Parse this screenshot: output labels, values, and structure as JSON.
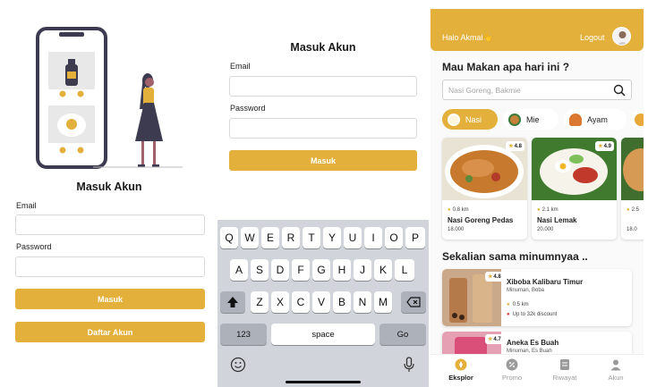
{
  "login1": {
    "title": "Masuk Akun",
    "email_label": "Email",
    "email_value": "",
    "password_label": "Password",
    "password_value": "",
    "login_button": "Masuk",
    "register_button": "Daftar Akun"
  },
  "login2": {
    "title": "Masuk Akun",
    "email_label": "Email",
    "email_value": "",
    "password_label": "Password",
    "password_value": "",
    "login_button": "Masuk"
  },
  "keyboard": {
    "row1": [
      "Q",
      "W",
      "E",
      "R",
      "T",
      "Y",
      "U",
      "I",
      "O",
      "P"
    ],
    "row2": [
      "A",
      "S",
      "D",
      "F",
      "G",
      "H",
      "J",
      "K",
      "L"
    ],
    "row3": [
      "Z",
      "X",
      "C",
      "V",
      "B",
      "N",
      "M"
    ],
    "numbers": "123",
    "space": "space",
    "go": "Go",
    "icons": [
      "shift-icon",
      "backspace-icon",
      "emoji-icon",
      "microphone-icon"
    ]
  },
  "home": {
    "greeting": "Halo Akmal👋",
    "logout": "Logout",
    "question": "Mau Makan apa hari ini ?",
    "search_placeholder": "Nasi Goreng, Bakmie",
    "categories": [
      {
        "label": "Nasi",
        "active": true
      },
      {
        "label": "Mie",
        "active": false
      },
      {
        "label": "Ayam",
        "active": false
      }
    ],
    "foods": [
      {
        "name": "Nasi Goreng Pedas",
        "distance": "0.8 km",
        "price": "18.000",
        "rating": "4.8"
      },
      {
        "name": "Nasi Lemak",
        "distance": "2.1 km",
        "price": "20.000",
        "rating": "4.9"
      },
      {
        "name": "",
        "distance": "2.5",
        "price": "18.0",
        "rating": ""
      }
    ],
    "drinks_title": "Sekalian sama minumnyaa ..",
    "drinks": [
      {
        "name": "Xiboba Kalibaru Timur",
        "subtitle": "Minuman, Boba",
        "distance": "0.5 km",
        "promo": "Up to 32k discount",
        "rating": "4.8"
      },
      {
        "name": "Aneka Es Buah",
        "subtitle": "Minuman, Es Buah",
        "distance": "",
        "promo": "",
        "rating": "4.7"
      }
    ],
    "nav": [
      {
        "label": "Eksplor",
        "active": true
      },
      {
        "label": "Promo",
        "active": false
      },
      {
        "label": "Riwayat",
        "active": false
      },
      {
        "label": "Akun",
        "active": false
      }
    ]
  },
  "colors": {
    "accent": "#e3b13b",
    "keyboard_bg": "#d1d4da",
    "illustration_dark": "#3d3b4f"
  }
}
